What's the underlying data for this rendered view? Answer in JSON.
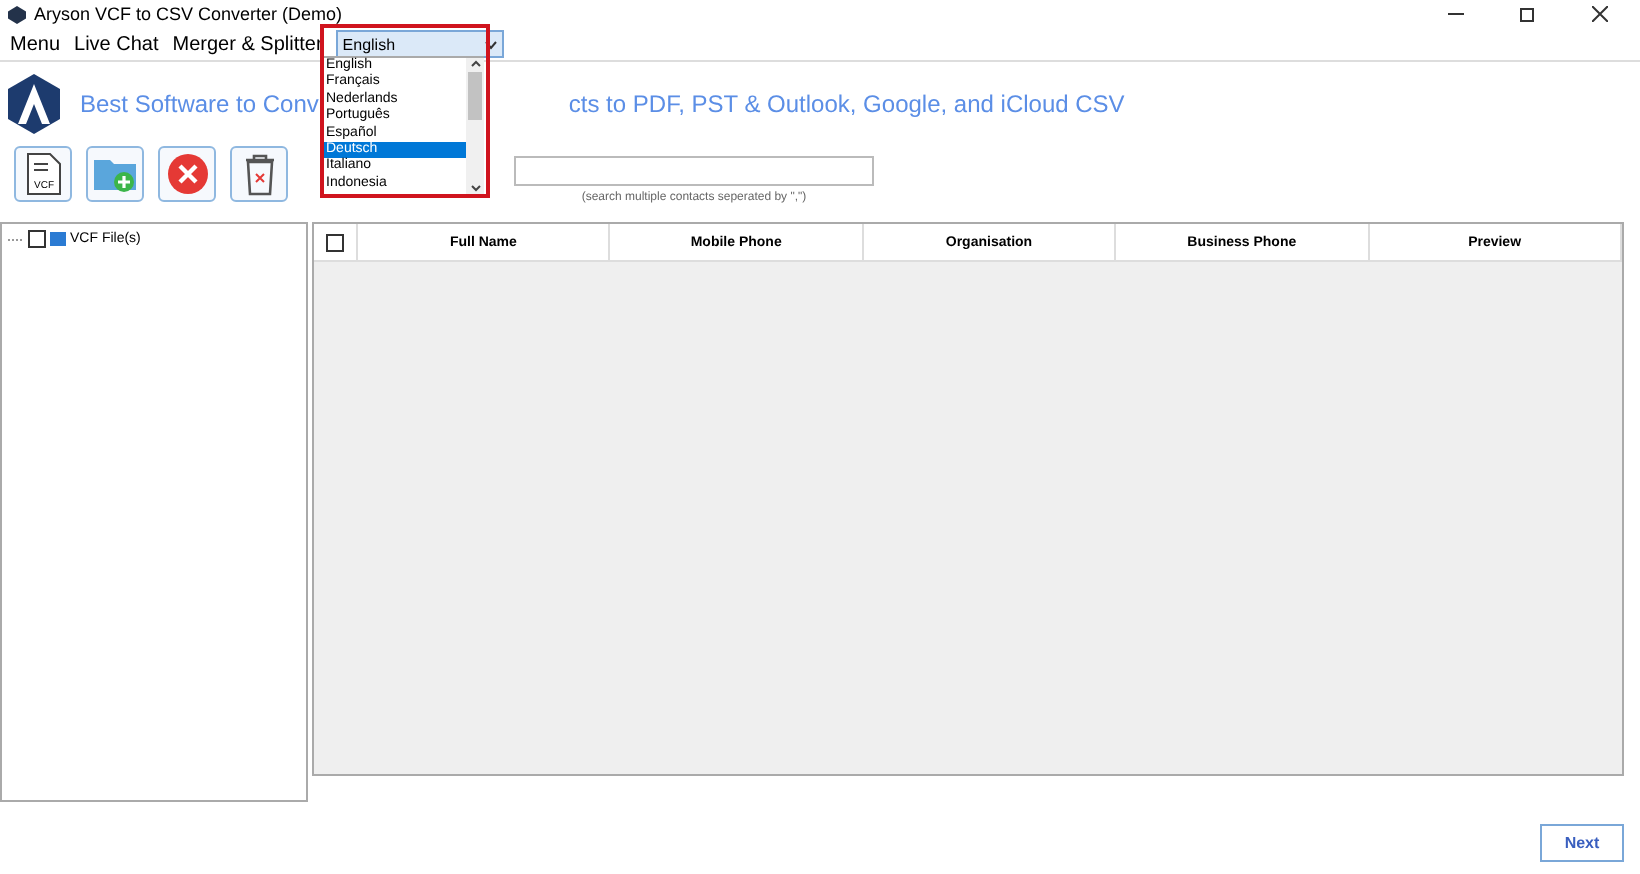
{
  "window": {
    "title": "Aryson VCF to CSV Converter (Demo)"
  },
  "menu": [
    "Menu",
    "Live Chat",
    "Merger & Splitter"
  ],
  "language": {
    "value": "English",
    "options": [
      {
        "label": "English",
        "highlighted": false
      },
      {
        "label": "Français",
        "highlighted": false
      },
      {
        "label": "Nederlands",
        "highlighted": false
      },
      {
        "label": "Português",
        "highlighted": false
      },
      {
        "label": "Español",
        "highlighted": false
      },
      {
        "label": "Deutsch",
        "highlighted": true
      },
      {
        "label": "Italiano",
        "highlighted": false
      },
      {
        "label": "Indonesia",
        "highlighted": false
      }
    ]
  },
  "heading": [
    "Best Software to Conv",
    "cts to PDF, PST & Outlook, Google, and iCloud CSV"
  ],
  "toolbar": [
    {
      "kind": "vcf",
      "label": "VCF"
    },
    {
      "kind": "add"
    },
    {
      "kind": "remove"
    },
    {
      "kind": "trash"
    }
  ],
  "search": {
    "hint": "(search multiple contacts seperated by \",\")"
  },
  "tree": [
    {
      "label": "VCF File(s)",
      "checked": false
    }
  ],
  "table": {
    "columns": [
      "Full Name",
      "Mobile Phone",
      "Organisation",
      "Business Phone",
      "Preview"
    ],
    "all_checked": false
  },
  "next": "Next"
}
